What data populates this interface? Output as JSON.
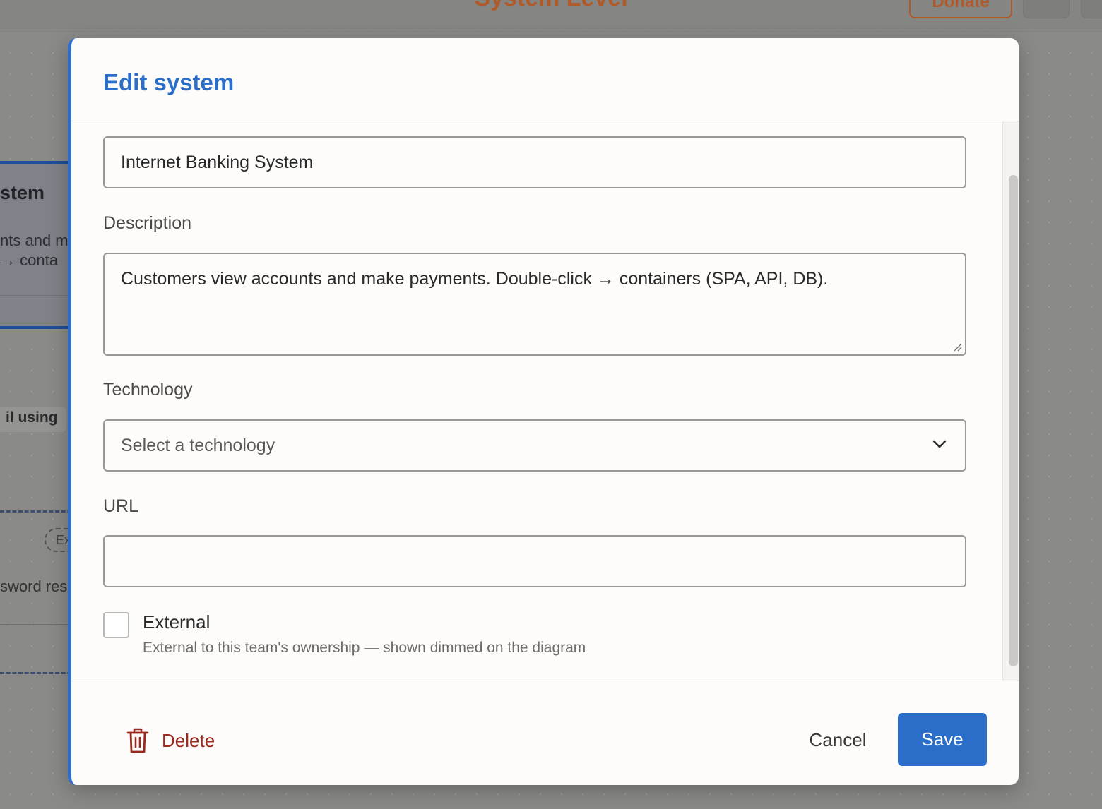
{
  "background": {
    "app_title": "System Level",
    "donate_label": "Donate",
    "card": {
      "title": "stem",
      "line1": "nts and m",
      "line2": "→ conta"
    },
    "pill_text": "il using",
    "dashed_tag": "Ex",
    "dashed_text": "sword res"
  },
  "modal": {
    "title": "Edit system",
    "name_value": "Internet Banking System",
    "description_label": "Description",
    "description_value": "Customers view accounts and make payments. Double-click → containers (SPA, API, DB).",
    "technology_label": "Technology",
    "technology_placeholder": "Select a technology",
    "url_label": "URL",
    "url_value": "",
    "external_label": "External",
    "external_help": "External to this team's ownership — shown dimmed on the diagram",
    "external_checked": false
  },
  "footer": {
    "delete_label": "Delete",
    "cancel_label": "Cancel",
    "save_label": "Save"
  },
  "colors": {
    "accent": "#2a6ec9",
    "danger": "#9a2a1e",
    "brand_orange": "#b05a2a"
  },
  "icons": {
    "delete": "trash-icon",
    "select": "chevron-down-icon"
  }
}
